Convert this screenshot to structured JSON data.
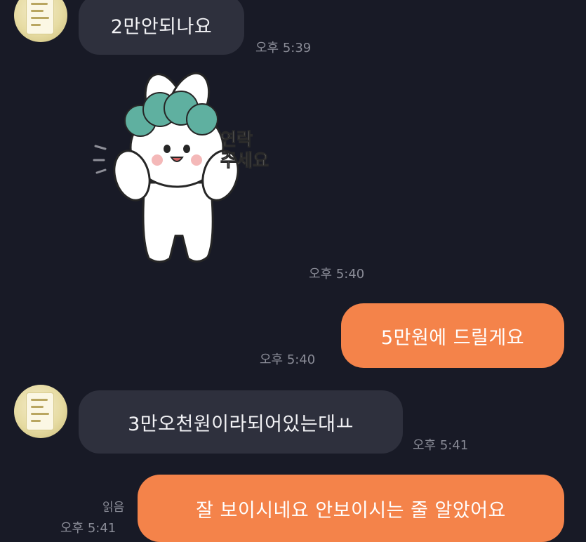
{
  "chat": {
    "messages": [
      {
        "side": "in",
        "text": "2만안되나요",
        "time": "오후 5:39"
      },
      {
        "side": "in",
        "type": "sticker",
        "sticker_text": [
          "연락",
          "주세요"
        ],
        "time": "오후 5:40"
      },
      {
        "side": "out",
        "text": "5만원에 드릴게요",
        "time": "오후 5:40"
      },
      {
        "side": "in",
        "text": "3만오천원이라되어있는대ㅛ",
        "time": "오후 5:41"
      },
      {
        "side": "out",
        "text": "잘 보이시네요 안보이시는 줄 알았어요",
        "read": "읽음",
        "time": "오후 5:41"
      }
    ]
  },
  "colors": {
    "background": "#181a26",
    "incoming_bubble": "#2e303d",
    "outgoing_bubble": "#f4834a",
    "timestamp": "#8a8c97"
  },
  "icons": {
    "avatar": "profile-photo",
    "sticker": "white-rabbit-green-hair-sticker"
  }
}
